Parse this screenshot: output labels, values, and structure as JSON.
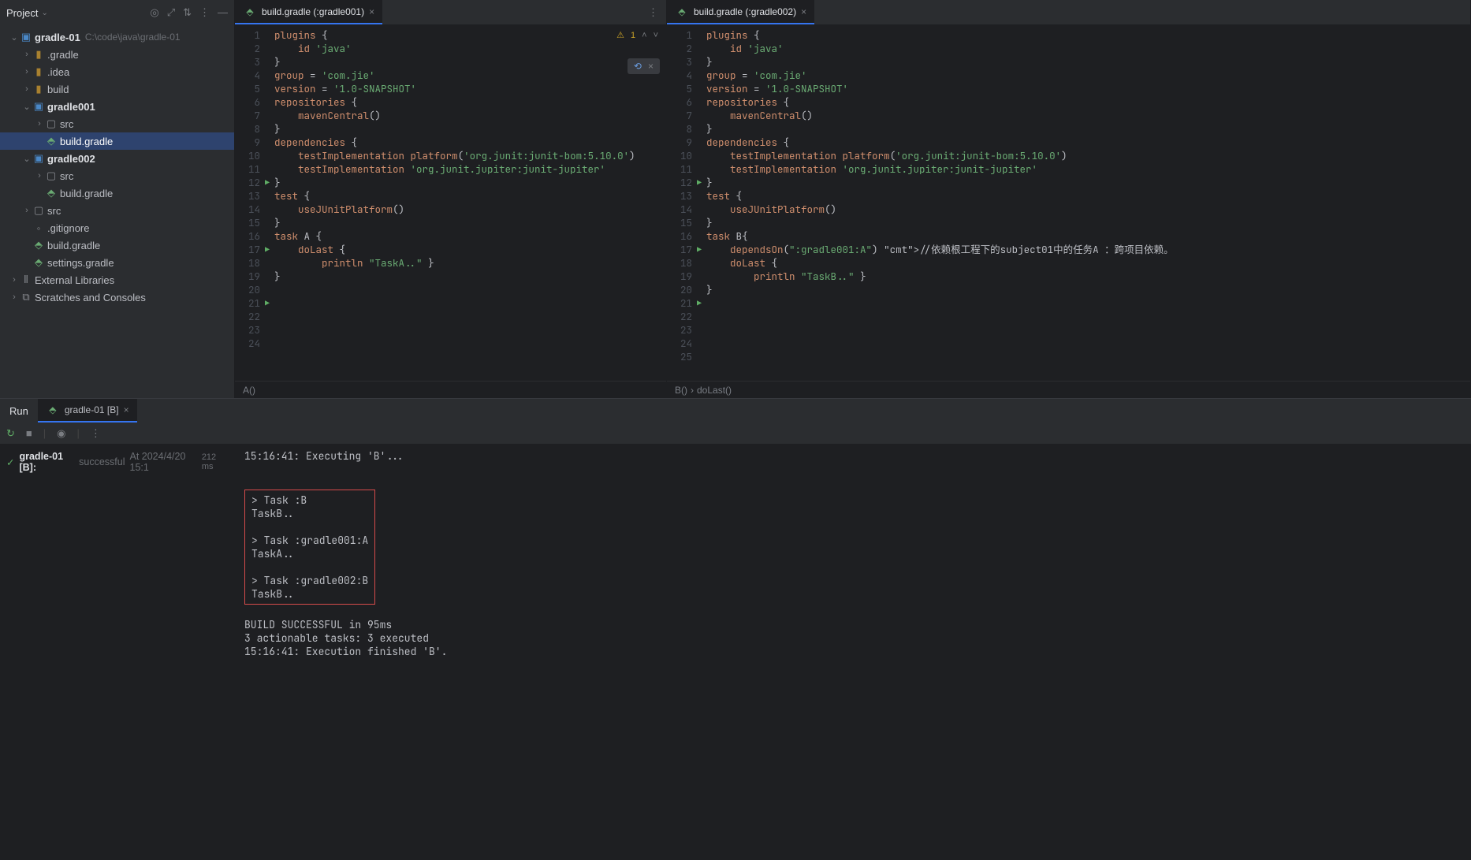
{
  "sidebar": {
    "title": "Project",
    "root": {
      "name": "gradle-01",
      "path": "C:\\code\\java\\gradle-01"
    },
    "nodes": {
      "dot_gradle": ".gradle",
      "dot_idea": ".idea",
      "build": "build",
      "gradle001": "gradle001",
      "g001_src": "src",
      "g001_build": "build.gradle",
      "gradle002": "gradle002",
      "g002_src": "src",
      "g002_build": "build.gradle",
      "src": "src",
      "gitignore": ".gitignore",
      "root_build": "build.gradle",
      "settings": "settings.gradle",
      "ext_lib": "External Libraries",
      "scratches": "Scratches and Consoles"
    }
  },
  "editor1": {
    "tab_label": "build.gradle (:gradle001)",
    "warning_count": "1",
    "breadcrumb": "A()",
    "lines": [
      "plugins {",
      "    id 'java'",
      "}",
      "",
      "group = 'com.jie'",
      "version = '1.0-SNAPSHOT'",
      "",
      "repositories {",
      "    mavenCentral()",
      "}",
      "",
      "dependencies {",
      "    testImplementation platform('org.junit:junit-bom:5.10.0')",
      "    testImplementation 'org.junit.jupiter:junit-jupiter'",
      "}",
      "",
      "test {",
      "    useJUnitPlatform()",
      "}",
      "",
      "task A {",
      "    doLast {",
      "        println \"TaskA..\" }",
      "}"
    ]
  },
  "editor2": {
    "tab_label": "build.gradle (:gradle002)",
    "breadcrumb_a": "B()",
    "breadcrumb_b": "doLast()",
    "lines": [
      "plugins {",
      "    id 'java'",
      "}",
      "",
      "group = 'com.jie'",
      "version = '1.0-SNAPSHOT'",
      "",
      "repositories {",
      "    mavenCentral()",
      "}",
      "",
      "dependencies {",
      "    testImplementation platform('org.junit:junit-bom:5.10.0')",
      "    testImplementation 'org.junit.jupiter:junit-jupiter'",
      "}",
      "",
      "test {",
      "    useJUnitPlatform()",
      "}",
      "",
      "task B{",
      "    dependsOn(\":gradle001:A\") //依赖根工程下的subject01中的任务A ：跨项目依赖。",
      "    doLast {",
      "        println \"TaskB..\" }",
      "}"
    ]
  },
  "run": {
    "panel_title": "Run",
    "tab_label": "gradle-01 [B]",
    "result_main": "gradle-01 [B]:",
    "result_status": "successful",
    "result_time": "At 2024/4/20 15:1",
    "result_dur": "212 ms",
    "console_head": "15:16:41: Executing 'B'...",
    "console_boxed": "> Task :B\nTaskB..\n\n> Task :gradle001:A\nTaskA..\n\n> Task :gradle002:B\nTaskB..",
    "console_tail": "BUILD SUCCESSFUL in 95ms\n3 actionable tasks: 3 executed\n15:16:41: Execution finished 'B'."
  }
}
